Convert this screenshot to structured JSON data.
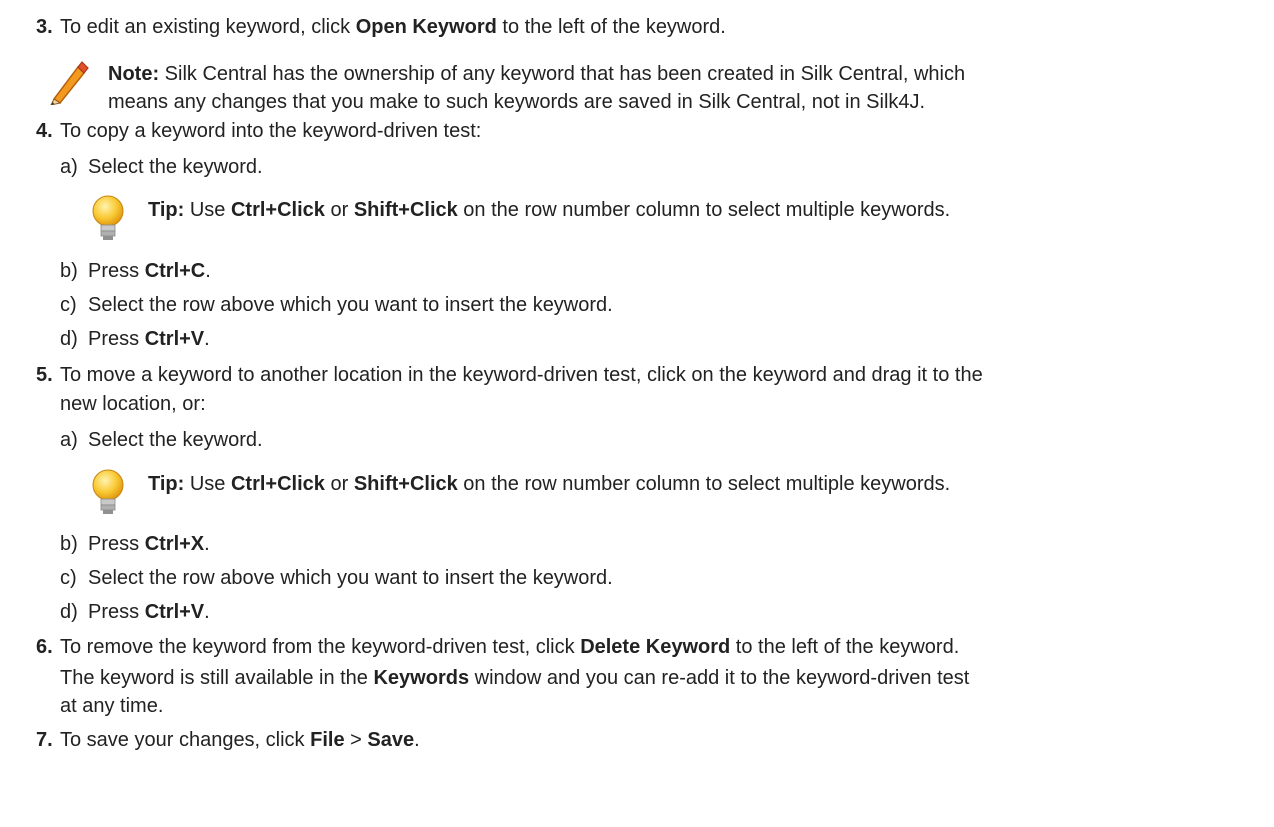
{
  "steps": [
    {
      "number": "3.",
      "parts": [
        "To edit an existing keyword, click ",
        "Open Keyword",
        " to the left of the keyword."
      ],
      "note": {
        "label": "Note:",
        "line1": " Silk Central has the ownership of any keyword that has been created in Silk Central, which",
        "line2": "means any changes that you make to such keywords are saved in Silk Central, not in Silk4J."
      }
    },
    {
      "number": "4.",
      "text": "To copy a keyword into the keyword-driven test:",
      "substeps": [
        {
          "marker": "a)",
          "text": "Select the keyword."
        },
        {
          "marker": "b)",
          "pre": "Press ",
          "bold": "Ctrl+C",
          "post": "."
        },
        {
          "marker": "c)",
          "text": "Select the row above which you want to insert the keyword."
        },
        {
          "marker": "d)",
          "pre": "Press ",
          "bold": "Ctrl+V",
          "post": "."
        }
      ],
      "tip": {
        "label": "Tip:",
        "pre": " Use ",
        "b1": "Ctrl+Click",
        "mid": " or ",
        "b2": "Shift+Click",
        "post": " on the row number column to select multiple keywords."
      }
    },
    {
      "number": "5.",
      "line1": "To move a keyword to another location in the keyword-driven test, click on the keyword and drag it to the",
      "line2": "new location, or:",
      "substeps": [
        {
          "marker": "a)",
          "text": "Select the keyword."
        },
        {
          "marker": "b)",
          "pre": "Press ",
          "bold": "Ctrl+X",
          "post": "."
        },
        {
          "marker": "c)",
          "text": "Select the row above which you want to insert the keyword."
        },
        {
          "marker": "d)",
          "pre": "Press ",
          "bold": "Ctrl+V",
          "post": "."
        }
      ],
      "tip": {
        "label": "Tip:",
        "pre": " Use ",
        "b1": "Ctrl+Click",
        "mid": " or ",
        "b2": "Shift+Click",
        "post": " on the row number column to select multiple keywords."
      }
    },
    {
      "number": "6.",
      "parts": [
        "To remove the keyword from the keyword-driven test, click ",
        "Delete Keyword",
        " to the left of the keyword."
      ],
      "para": {
        "pre": "The keyword is still available in the ",
        "bold": "Keywords",
        "post": " window and you can re-add it to the keyword-driven test",
        "line2": "at any time."
      }
    },
    {
      "number": "7.",
      "parts": [
        "To save your changes, click ",
        "File",
        " > ",
        "Save",
        "."
      ]
    }
  ]
}
